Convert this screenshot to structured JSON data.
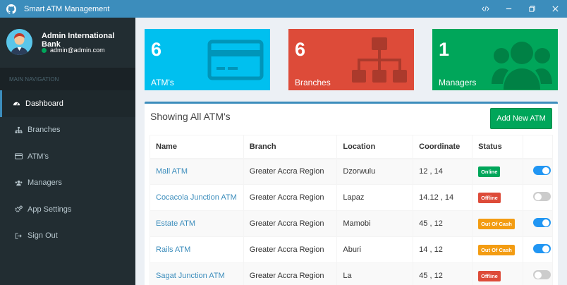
{
  "window": {
    "title": "Smart ATM Management"
  },
  "user": {
    "name": "Admin International Bank",
    "email": "admin@admin.com"
  },
  "nav": {
    "header": "MAIN NAVIGATION",
    "items": [
      {
        "label": "Dashboard",
        "icon": "dashboard-icon"
      },
      {
        "label": "Branches",
        "icon": "sitemap-icon"
      },
      {
        "label": "ATM's",
        "icon": "credit-card-icon"
      },
      {
        "label": "Managers",
        "icon": "users-icon"
      },
      {
        "label": "App Settings",
        "icon": "cogs-icon"
      },
      {
        "label": "Sign Out",
        "icon": "sign-out-icon"
      }
    ]
  },
  "stats": [
    {
      "value": "6",
      "label": "ATM's",
      "color": "#00c0ef",
      "icon": "credit-card-icon"
    },
    {
      "value": "6",
      "label": "Branches",
      "color": "#dd4b39",
      "icon": "sitemap-icon"
    },
    {
      "value": "1",
      "label": "Managers",
      "color": "#00a65a",
      "icon": "users-icon"
    }
  ],
  "panel": {
    "title": "Showing All ATM's",
    "add_button": "Add New ATM"
  },
  "table": {
    "headers": [
      "Name",
      "Branch",
      "Location",
      "Coordinate",
      "Status",
      ""
    ],
    "rows": [
      {
        "name": "Mall ATM",
        "branch": "Greater Accra Region",
        "location": "Dzorwulu",
        "coordinate": "12 , 14",
        "status": "Online",
        "enabled": true
      },
      {
        "name": "Cocacola Junction ATM",
        "branch": "Greater Accra Region",
        "location": "Lapaz",
        "coordinate": "14.12 , 14",
        "status": "Offline",
        "enabled": false
      },
      {
        "name": "Estate ATM",
        "branch": "Greater Accra Region",
        "location": "Mamobi",
        "coordinate": "45 , 12",
        "status": "Out Of Cash",
        "enabled": true
      },
      {
        "name": "Rails ATM",
        "branch": "Greater Accra Region",
        "location": "Aburi",
        "coordinate": "14 , 12",
        "status": "Out Of Cash",
        "enabled": true
      },
      {
        "name": "Sagat Junction ATM",
        "branch": "Greater Accra Region",
        "location": "La",
        "coordinate": "45 , 12",
        "status": "Offline",
        "enabled": false
      }
    ]
  },
  "colors": {
    "online": "#00a65a",
    "offline": "#dd4b39",
    "out_of_cash": "#f39c12",
    "primary": "#3c8dbc"
  }
}
